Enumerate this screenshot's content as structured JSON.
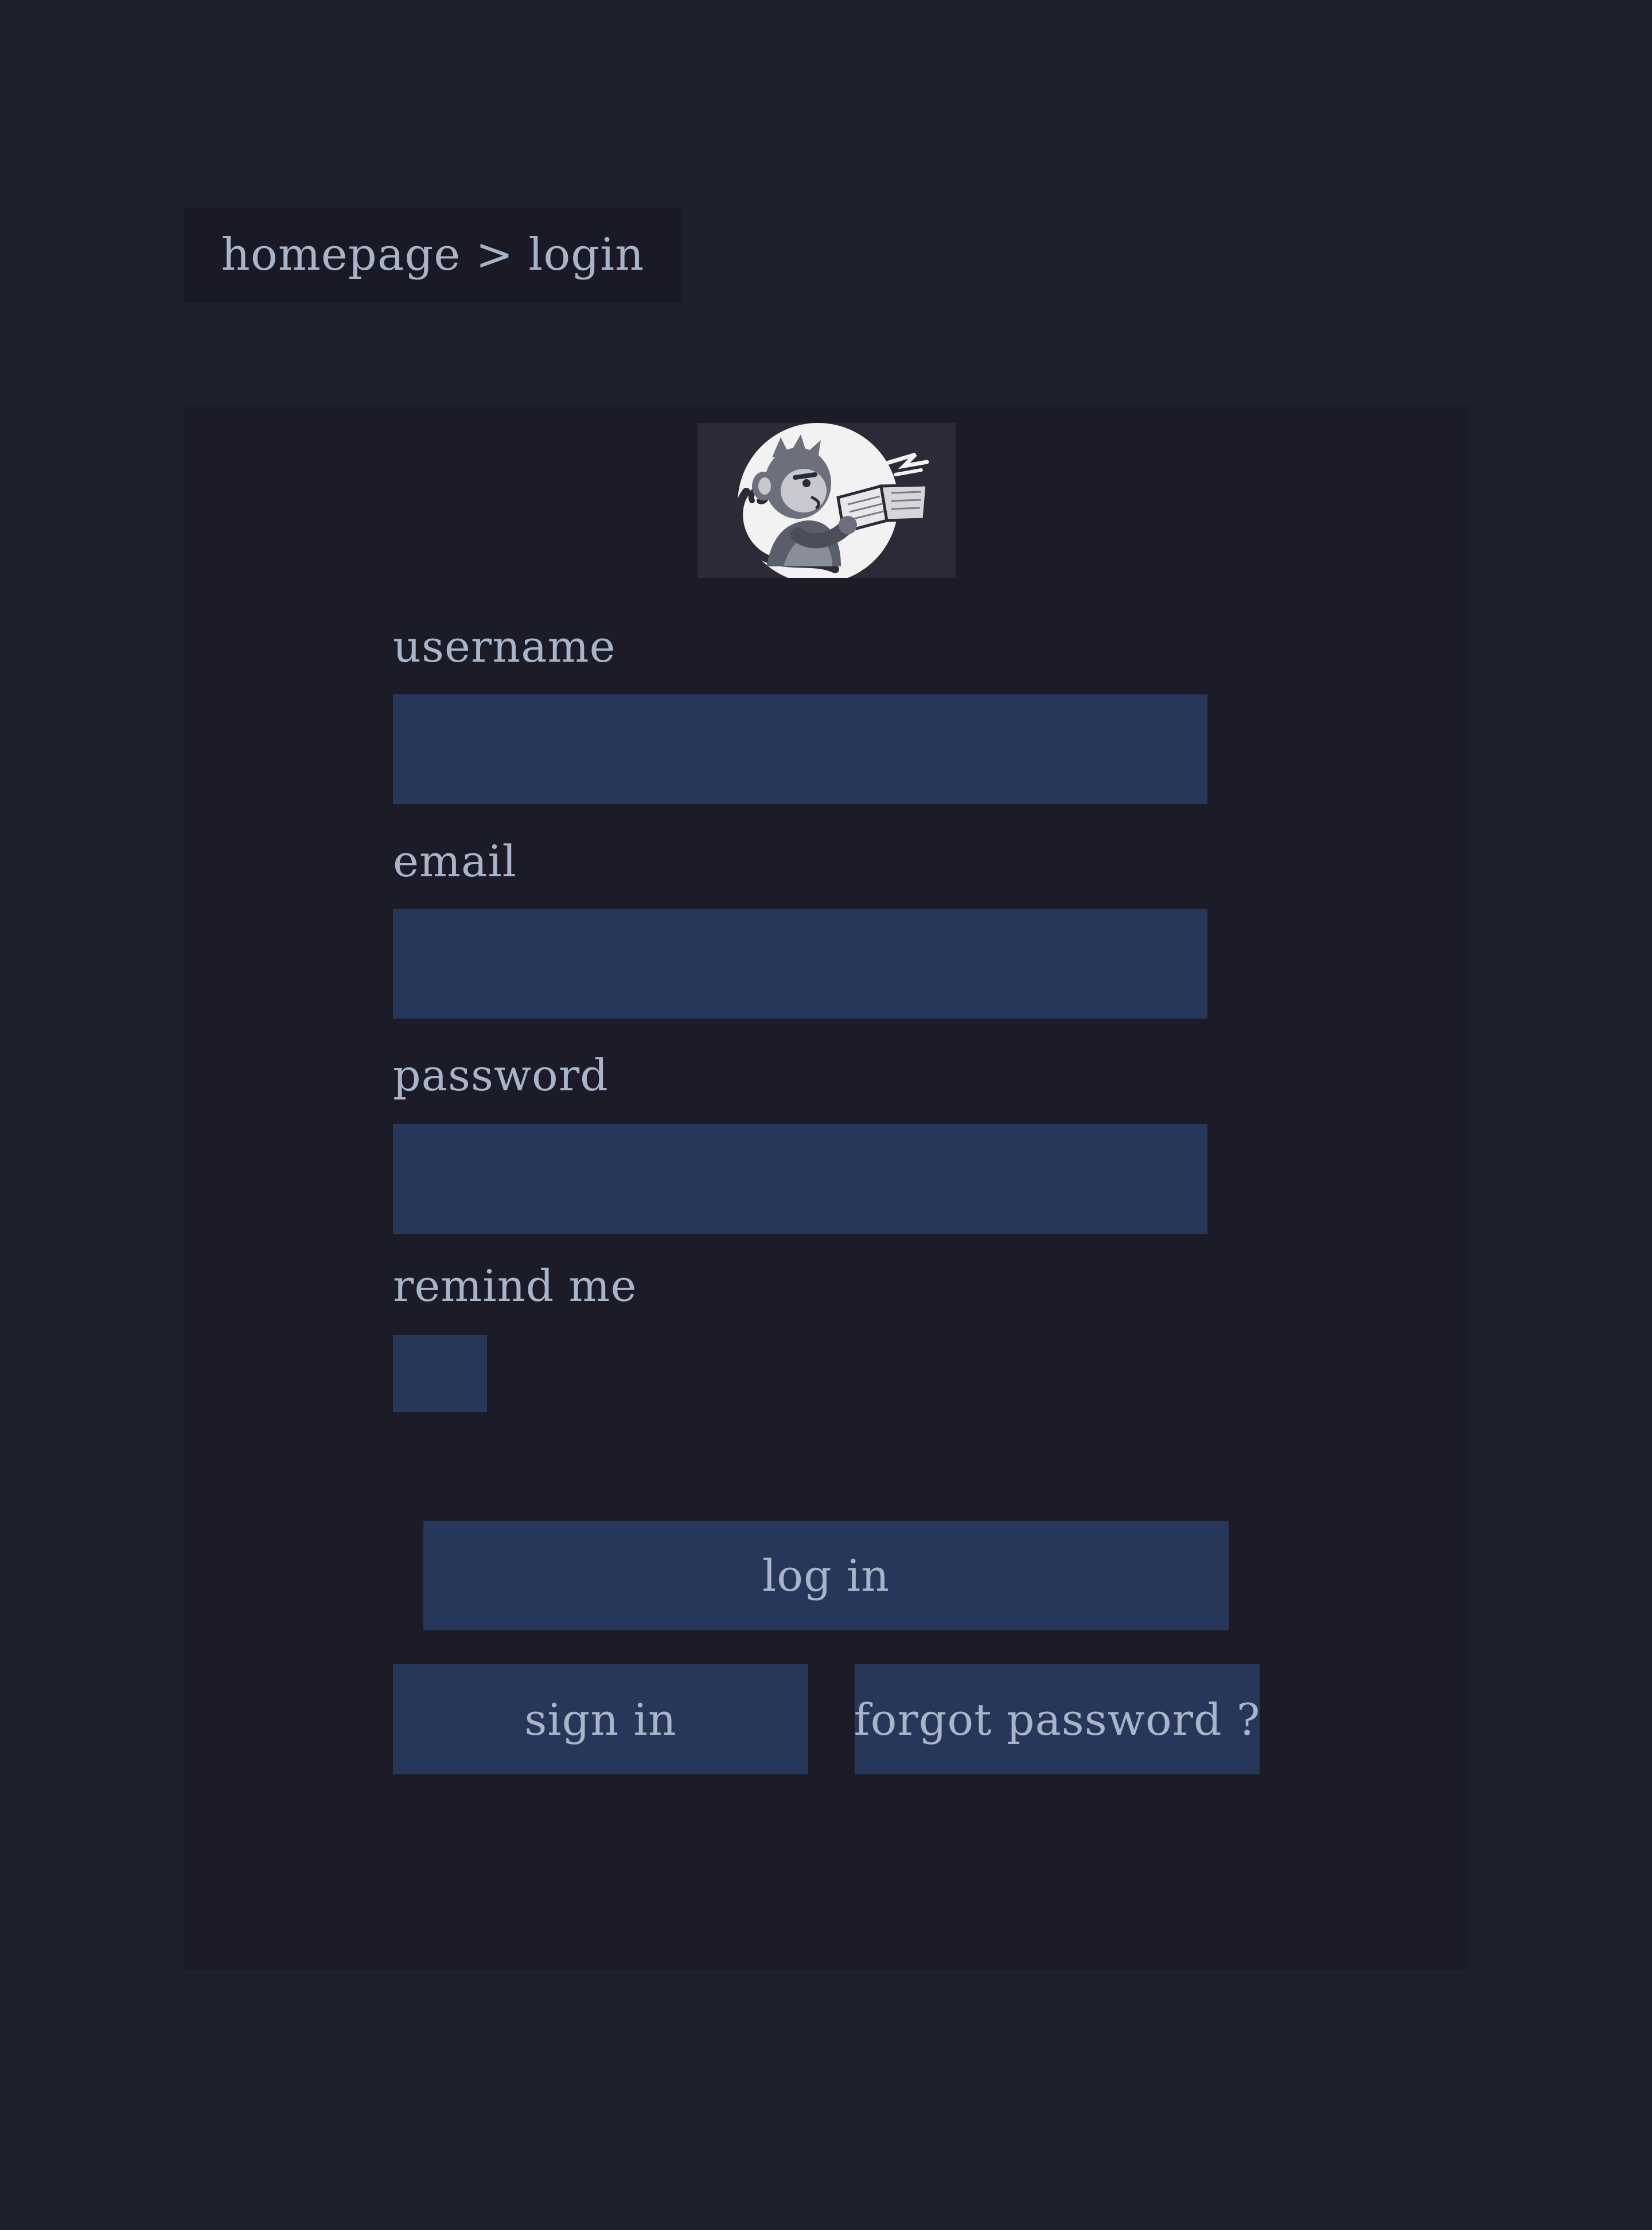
{
  "breadcrumb": {
    "text": "homepage > login"
  },
  "logo": {
    "icon": "monkey-reading-book-logo"
  },
  "form": {
    "username": {
      "label": "username",
      "value": "",
      "placeholder": ""
    },
    "email": {
      "label": "email",
      "value": "",
      "placeholder": ""
    },
    "password": {
      "label": "password",
      "value": "",
      "placeholder": ""
    },
    "remind": {
      "label": "remind me",
      "checked": false
    }
  },
  "buttons": {
    "login": "log in",
    "signin": "sign in",
    "forgot": "forgot password ?"
  },
  "colors": {
    "page_background": "#1f202d",
    "panel_background": "#1b1c28",
    "breadcrumb_background": "#191a25",
    "input_background": "#26375a",
    "text": "#a9b4c9"
  }
}
